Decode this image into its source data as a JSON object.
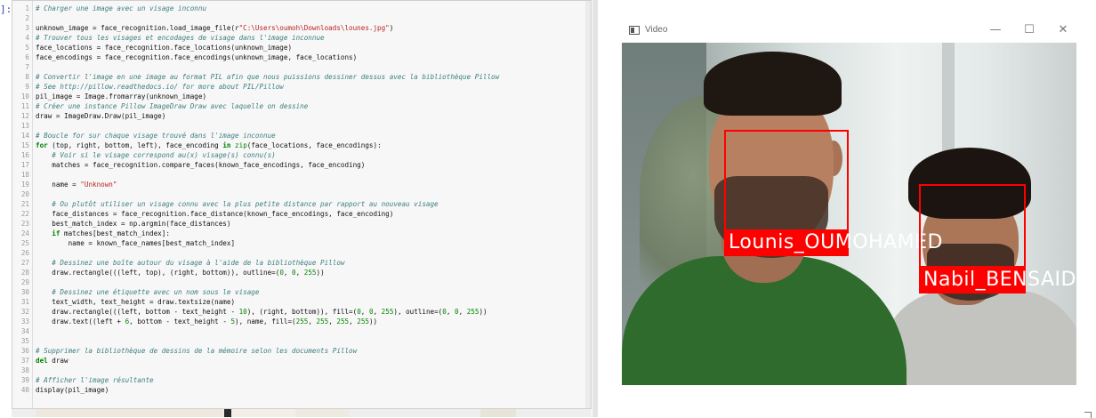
{
  "notebook": {
    "prompt": "]:",
    "lines": [
      {
        "n": "1",
        "parts": [
          {
            "t": "# Charger une image avec un visage inconnu",
            "c": "cmt"
          }
        ]
      },
      {
        "n": "2",
        "parts": []
      },
      {
        "n": "3",
        "parts": [
          {
            "t": "unknown_image = face_recognition.load_image_file(r",
            "c": ""
          },
          {
            "t": "\"C:\\Users\\oumoh\\Downloads\\lounes.jpg\"",
            "c": "str"
          },
          {
            "t": ")",
            "c": ""
          }
        ]
      },
      {
        "n": "4",
        "parts": [
          {
            "t": "# Trouver tous les visages et encodages de visage dans l'image inconnue",
            "c": "cmt"
          }
        ]
      },
      {
        "n": "5",
        "parts": [
          {
            "t": "face_locations = face_recognition.face_locations(unknown_image)",
            "c": ""
          }
        ]
      },
      {
        "n": "6",
        "parts": [
          {
            "t": "face_encodings = face_recognition.face_encodings(unknown_image, face_locations)",
            "c": ""
          }
        ]
      },
      {
        "n": "7",
        "parts": []
      },
      {
        "n": "8",
        "parts": [
          {
            "t": "# Convertir l'image en une image au format PIL afin que nous puissions dessiner dessus avec la bibliothèque Pillow",
            "c": "cmt"
          }
        ]
      },
      {
        "n": "9",
        "parts": [
          {
            "t": "# See http://pillow.readthedocs.io/ for more about PIL/Pillow",
            "c": "cmt"
          }
        ]
      },
      {
        "n": "10",
        "parts": [
          {
            "t": "pil_image = Image.fromarray(unknown_image)",
            "c": ""
          }
        ]
      },
      {
        "n": "11",
        "parts": [
          {
            "t": "# Créer une instance Pillow ImageDraw Draw avec laquelle on dessine",
            "c": "cmt"
          }
        ]
      },
      {
        "n": "12",
        "parts": [
          {
            "t": "draw = ImageDraw.Draw(pil_image)",
            "c": ""
          }
        ]
      },
      {
        "n": "13",
        "parts": []
      },
      {
        "n": "14",
        "parts": [
          {
            "t": "# Boucle for sur chaque visage trouvé dans l'image inconnue",
            "c": "cmt"
          }
        ]
      },
      {
        "n": "15",
        "parts": [
          {
            "t": "for",
            "c": "kw"
          },
          {
            "t": " (top, right, bottom, left), face_encoding ",
            "c": ""
          },
          {
            "t": "in",
            "c": "kw"
          },
          {
            "t": " ",
            "c": ""
          },
          {
            "t": "zip",
            "c": "bi"
          },
          {
            "t": "(face_locations, face_encodings):",
            "c": ""
          }
        ]
      },
      {
        "n": "16",
        "parts": [
          {
            "t": "    # Voir si le visage correspond au(x) visage(s) connu(s)",
            "c": "cmt"
          }
        ]
      },
      {
        "n": "17",
        "parts": [
          {
            "t": "    matches = face_recognition.compare_faces(known_face_encodings, face_encoding)",
            "c": ""
          }
        ]
      },
      {
        "n": "18",
        "parts": []
      },
      {
        "n": "19",
        "parts": [
          {
            "t": "    name = ",
            "c": ""
          },
          {
            "t": "\"Unknown\"",
            "c": "str"
          }
        ]
      },
      {
        "n": "20",
        "parts": []
      },
      {
        "n": "21",
        "parts": [
          {
            "t": "    # Ou plutôt utiliser un visage connu avec la plus petite distance par rapport au nouveau visage",
            "c": "cmt"
          }
        ]
      },
      {
        "n": "22",
        "parts": [
          {
            "t": "    face_distances = face_recognition.face_distance(known_face_encodings, face_encoding)",
            "c": ""
          }
        ]
      },
      {
        "n": "23",
        "parts": [
          {
            "t": "    best_match_index = np.argmin(face_distances)",
            "c": ""
          }
        ]
      },
      {
        "n": "24",
        "parts": [
          {
            "t": "    ",
            "c": ""
          },
          {
            "t": "if",
            "c": "kw"
          },
          {
            "t": " matches[best_match_index]:",
            "c": ""
          }
        ]
      },
      {
        "n": "25",
        "parts": [
          {
            "t": "        name = known_face_names[best_match_index]",
            "c": ""
          }
        ]
      },
      {
        "n": "26",
        "parts": []
      },
      {
        "n": "27",
        "parts": [
          {
            "t": "    # Dessinez une boîte autour du visage à l'aide de la bibliothèque Pillow",
            "c": "cmt"
          }
        ]
      },
      {
        "n": "28",
        "parts": [
          {
            "t": "    draw.rectangle(((left, top), (right, bottom)), outline=(",
            "c": ""
          },
          {
            "t": "0",
            "c": "num"
          },
          {
            "t": ", ",
            "c": ""
          },
          {
            "t": "0",
            "c": "num"
          },
          {
            "t": ", ",
            "c": ""
          },
          {
            "t": "255",
            "c": "num"
          },
          {
            "t": "))",
            "c": ""
          }
        ]
      },
      {
        "n": "29",
        "parts": []
      },
      {
        "n": "30",
        "parts": [
          {
            "t": "    # Dessinez une étiquette avec un nom sous le visage",
            "c": "cmt"
          }
        ]
      },
      {
        "n": "31",
        "parts": [
          {
            "t": "    text_width, text_height = draw.textsize(name)",
            "c": ""
          }
        ]
      },
      {
        "n": "32",
        "parts": [
          {
            "t": "    draw.rectangle(((left, bottom - text_height - ",
            "c": ""
          },
          {
            "t": "10",
            "c": "num"
          },
          {
            "t": "), (right, bottom)), fill=(",
            "c": ""
          },
          {
            "t": "0",
            "c": "num"
          },
          {
            "t": ", ",
            "c": ""
          },
          {
            "t": "0",
            "c": "num"
          },
          {
            "t": ", ",
            "c": ""
          },
          {
            "t": "255",
            "c": "num"
          },
          {
            "t": "), outline=(",
            "c": ""
          },
          {
            "t": "0",
            "c": "num"
          },
          {
            "t": ", ",
            "c": ""
          },
          {
            "t": "0",
            "c": "num"
          },
          {
            "t": ", ",
            "c": ""
          },
          {
            "t": "255",
            "c": "num"
          },
          {
            "t": "))",
            "c": ""
          }
        ]
      },
      {
        "n": "33",
        "parts": [
          {
            "t": "    draw.text((left + ",
            "c": ""
          },
          {
            "t": "6",
            "c": "num"
          },
          {
            "t": ", bottom - text_height - ",
            "c": ""
          },
          {
            "t": "5",
            "c": "num"
          },
          {
            "t": "), name, fill=(",
            "c": ""
          },
          {
            "t": "255",
            "c": "num"
          },
          {
            "t": ", ",
            "c": ""
          },
          {
            "t": "255",
            "c": "num"
          },
          {
            "t": ", ",
            "c": ""
          },
          {
            "t": "255",
            "c": "num"
          },
          {
            "t": ", ",
            "c": ""
          },
          {
            "t": "255",
            "c": "num"
          },
          {
            "t": "))",
            "c": ""
          }
        ]
      },
      {
        "n": "34",
        "parts": []
      },
      {
        "n": "35",
        "parts": []
      },
      {
        "n": "36",
        "parts": [
          {
            "t": "# Supprimer la bibliothèque de dessins de la mémoire selon les documents Pillow",
            "c": "cmt"
          }
        ]
      },
      {
        "n": "37",
        "parts": [
          {
            "t": "del",
            "c": "kw"
          },
          {
            "t": " draw",
            "c": ""
          }
        ]
      },
      {
        "n": "38",
        "parts": []
      },
      {
        "n": "39",
        "parts": [
          {
            "t": "# Afficher l'image résultante",
            "c": "cmt"
          }
        ]
      },
      {
        "n": "40",
        "parts": [
          {
            "t": "display(pil_image)",
            "c": ""
          }
        ]
      }
    ]
  },
  "video_window": {
    "title": "Video",
    "minimize_glyph": "—",
    "maximize_glyph": "☐",
    "close_glyph": "✕",
    "detections": [
      {
        "label": "Lounis_OUMOHAMED",
        "box_color": "#ff0000"
      },
      {
        "label": "Nabil_BENSAID",
        "box_color": "#ff0000"
      }
    ]
  },
  "colors": {
    "comment": "#3d7f7f",
    "keyword": "#008000",
    "string": "#ba2121",
    "detection_box": "#ff0000"
  }
}
